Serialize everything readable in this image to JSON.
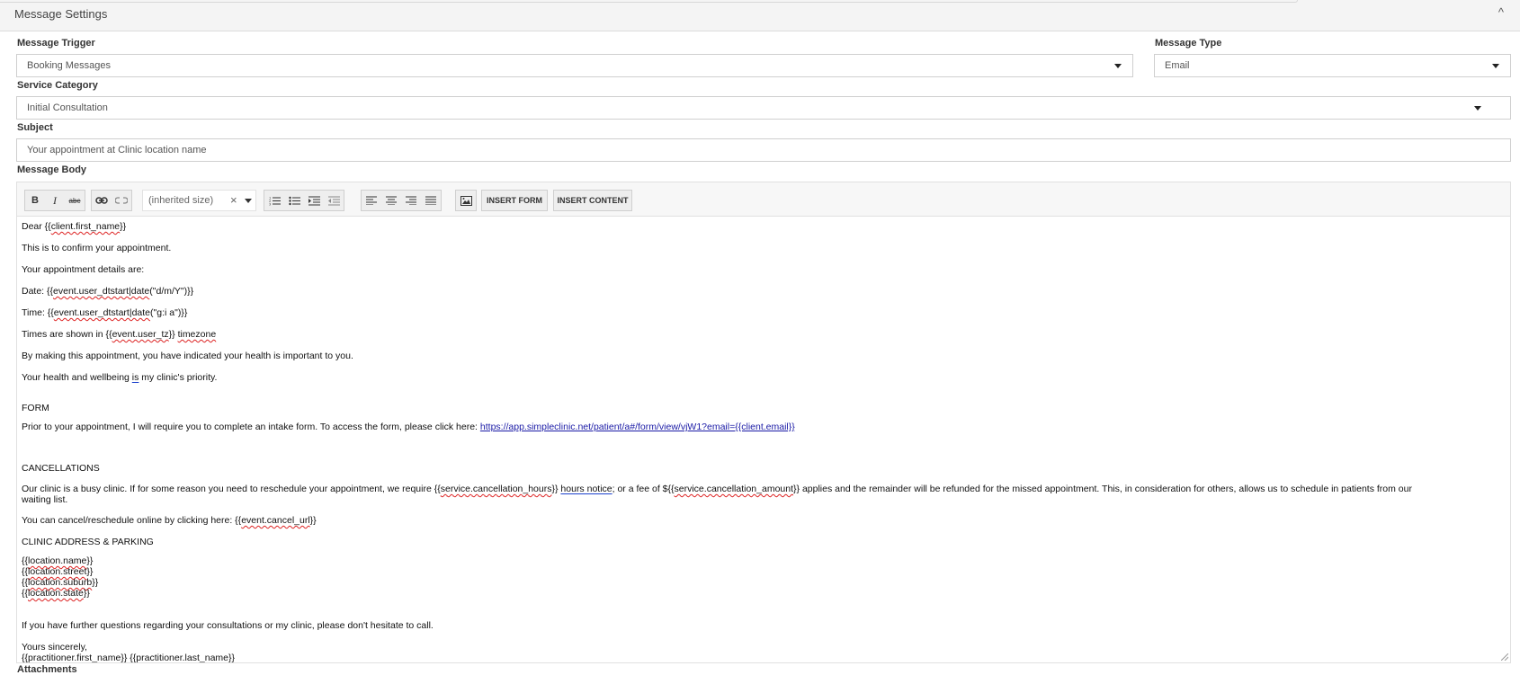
{
  "panel": {
    "title": "Message Settings",
    "collapse_icon": "chevron-up-icon",
    "collapse_glyph": "^"
  },
  "fields": {
    "trigger_label": "Message Trigger",
    "trigger_value": "Booking Messages",
    "type_label": "Message Type",
    "type_value": "Email",
    "category_label": "Service Category",
    "category_value": "Initial Consultation",
    "subject_label": "Subject",
    "subject_value": "Your appointment at Clinic location name",
    "body_label": "Message Body",
    "attachments_label": "Attachments"
  },
  "toolbar": {
    "bold": "B",
    "italic": "I",
    "strike": "abc",
    "font_size": "(inherited size)",
    "clear_glyph": "×",
    "insert_form": "INSERT FORM",
    "insert_content": "INSERT CONTENT",
    "icons": [
      "bold-icon",
      "italic-icon",
      "strikethrough-icon",
      "link-icon",
      "unlink-icon",
      "numbered-list-icon",
      "bulleted-list-icon",
      "indent-icon",
      "outdent-icon",
      "align-left-icon",
      "align-center-icon",
      "align-right-icon",
      "justify-icon",
      "image-icon"
    ]
  },
  "body": {
    "greeting_pre": "Dear {{",
    "greeting_var": "client.first_name",
    "greeting_post": "}}",
    "confirm": "This is to confirm your appointment.",
    "details": "Your appointment details are:",
    "date_pre": "Date: {{",
    "date_var": "event.user_dtstart|date",
    "date_post": "(\"d/m/Y\")}}",
    "time_pre": "Time: {{",
    "time_var": "event.user_dtstart|date",
    "time_post": "(\"g:i a\")}}",
    "tz_pre": "Times are shown in {{",
    "tz_var": "event.user_tz",
    "tz_mid": "}} ",
    "tz_word": "timezone",
    "health": "By making this appointment, you have indicated your health is important to you.",
    "priority_pre": "Your health and wellbeing ",
    "priority_is": "is",
    "priority_post": " my clinic's priority.",
    "form_heading": "FORM",
    "form_text": "Prior to your appointment, I will require you to complete an intake form. To access the form, please click here: ",
    "form_link": "https://app.simpleclinic.net/patient/a#/form/view/vjW1?email={{client.email}}",
    "cancel_heading": "CANCELLATIONS",
    "cancel_p1": "Our clinic is a busy clinic. If for some reason you need to reschedule your appointment, we require {{",
    "cancel_var1": "service.cancellation_hours",
    "cancel_p2": "}} ",
    "cancel_hours": "hours notice",
    "cancel_p3": "; or a fee of ${{",
    "cancel_var2": "service.cancellation_amount",
    "cancel_p4": "}} applies and the remainder will be refunded for the missed appointment. This, in consideration for others, allows us to schedule in patients from our",
    "cancel_line2": "waiting list.",
    "reschedule_pre": "You can cancel/reschedule online by clicking here: {{",
    "reschedule_var": "event.cancel_url",
    "reschedule_post": "}}",
    "address_heading": "CLINIC ADDRESS & PARKING",
    "loc_name": "location.name",
    "loc_street": "location.street",
    "loc_suburb": "location.suburb",
    "loc_state": "location.state",
    "questions": "If you have further questions regarding your consultations or my clinic, please don't hesitate to call.",
    "sincerely": "Yours sincerely,",
    "sig_var1": "practitioner.first_name",
    "sig_var2": "practitioner.last_name"
  }
}
